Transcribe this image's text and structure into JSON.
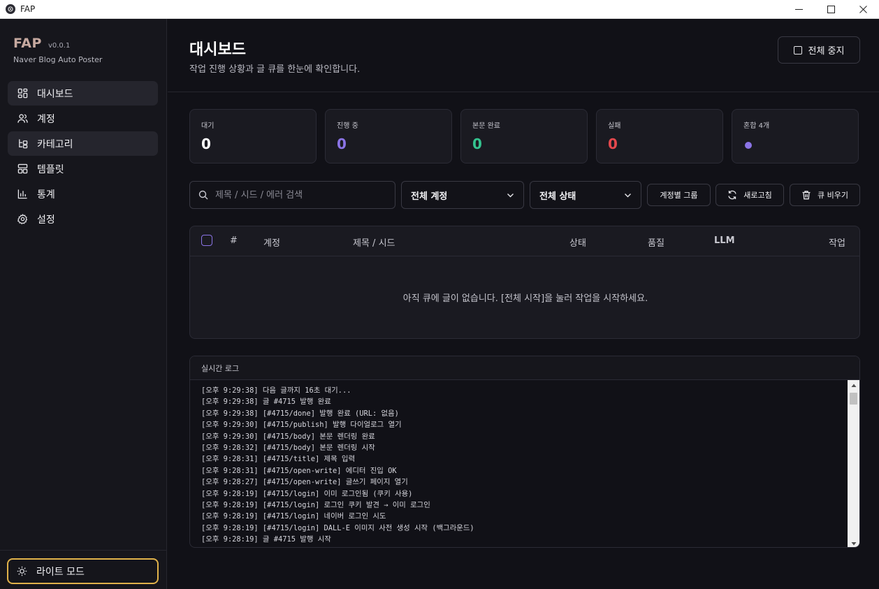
{
  "window": {
    "title": "FAP"
  },
  "brand": {
    "name": "FAP",
    "version": "v0.0.1",
    "subtitle": "Naver Blog Auto Poster"
  },
  "sidebar": {
    "items": [
      {
        "label": "대시보드",
        "icon": "dashboard-icon",
        "active": true
      },
      {
        "label": "계정",
        "icon": "users-icon",
        "active": false
      },
      {
        "label": "카테고리",
        "icon": "category-tree-icon",
        "active": false
      },
      {
        "label": "템플릿",
        "icon": "template-icon",
        "active": false
      },
      {
        "label": "통계",
        "icon": "bar-chart-icon",
        "active": false
      },
      {
        "label": "설정",
        "icon": "gear-icon",
        "active": false
      }
    ],
    "theme_button": {
      "label": "라이트 모드",
      "icon": "sun-icon"
    }
  },
  "header": {
    "title": "대시보드",
    "subtitle": "작업 진행 상황과 글 큐를 한눈에 확인합니다.",
    "stop_all_label": "전체 중지"
  },
  "stats": [
    {
      "label": "대기",
      "value": "0",
      "color": "#ffffff"
    },
    {
      "label": "진행 중",
      "value": "0",
      "color": "#8b74e6"
    },
    {
      "label": "본문 완료",
      "value": "0",
      "color": "#34c38f"
    },
    {
      "label": "실패",
      "value": "0",
      "color": "#e5484d"
    },
    {
      "label": "혼합 4개",
      "value": "",
      "color": "#8b74e6",
      "dot": true
    }
  ],
  "filters": {
    "search_placeholder": "제목 / 시드 / 에러 검색",
    "account_select": "전체 계정",
    "status_select": "전체 상태",
    "group_by_account": "계정별 그룹",
    "refresh": "새로고침",
    "clear_queue": "큐 비우기"
  },
  "table": {
    "columns": [
      "#",
      "계정",
      "제목 / 시드",
      "상태",
      "품질",
      "LLM",
      "작업"
    ],
    "empty_message": "아직 큐에 글이 없습니다. [전체 시작]을 눌러 작업을 시작하세요."
  },
  "log": {
    "title": "실시간 로그",
    "lines": [
      "[오후 9:29:38] 다음 글까지 16초 대기...",
      "[오후 9:29:38] 글 #4715 발행 완료",
      "[오후 9:29:38] [#4715/done] 발행 완료 (URL: 없음)",
      "[오후 9:29:30] [#4715/publish] 발행 다이얼로그 열기",
      "[오후 9:29:30] [#4715/body] 본문 렌더링 완료",
      "[오후 9:28:32] [#4715/body] 본문 렌더링 시작",
      "[오후 9:28:31] [#4715/title] 제목 입력",
      "[오후 9:28:31] [#4715/open-write] 에디터 진입 OK",
      "[오후 9:28:27] [#4715/open-write] 글쓰기 페이지 열기",
      "[오후 9:28:19] [#4715/login] 이미 로그인됨 (쿠키 사용)",
      "[오후 9:28:19] [#4715/login] 로그인 쿠키 발견 → 이미 로그인",
      "[오후 9:28:19] [#4715/login] 네이버 로그인 시도",
      "[오후 9:28:19] [#4715/login] DALL-E 이미지 사전 생성 시작 (백그라운드)",
      "[오후 9:28:19] 글 #4715 발행 시작"
    ]
  },
  "colors": {
    "accent_purple": "#8b74e6",
    "success_green": "#34c38f",
    "danger_red": "#e5484d",
    "theme_button_border": "#e0b24a",
    "brand_color": "#c6a9a0"
  }
}
